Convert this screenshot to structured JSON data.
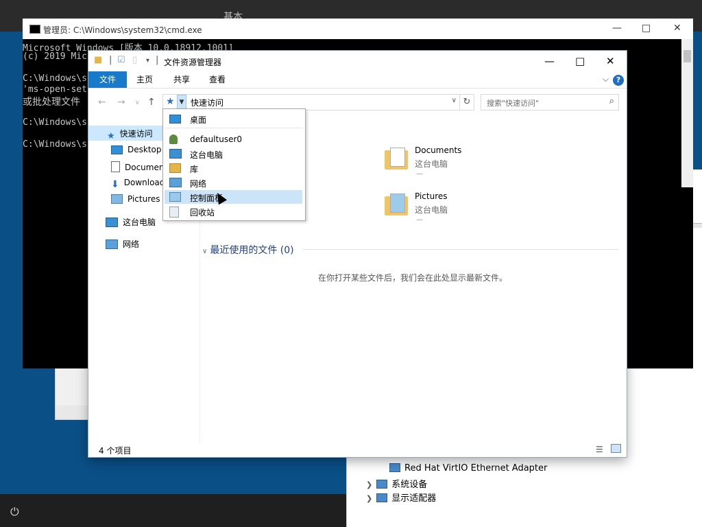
{
  "desktop": {
    "top_title": "基本"
  },
  "cmd": {
    "title": "管理员: C:\\Windows\\system32\\cmd.exe",
    "lines": [
      "Microsoft Windows [版本 10.0.18912.1001]",
      "(c) 2019 Mic",
      "C:\\Windows\\s",
      "'ms-open-set",
      "或批处理文件",
      "C:\\Windows\\s",
      "C:\\Windows\\s"
    ]
  },
  "explorer": {
    "title": "文件资源管理器",
    "ribbon": {
      "tabs": [
        "文件",
        "主页",
        "共享",
        "查看"
      ]
    },
    "address": {
      "text": "快速访问"
    },
    "search": {
      "placeholder": "搜索\"快速访问\""
    },
    "nav": {
      "quick_access": "快速访问",
      "items": [
        "Desktop",
        "Documen",
        "Download",
        "Pictures"
      ],
      "this_pc": "这台电脑",
      "network": "网络"
    },
    "folders": [
      {
        "name": "Documents",
        "location": "这台电脑"
      },
      {
        "name": "Pictures",
        "location": "这台电脑"
      }
    ],
    "recent_header": "最近使用的文件 (0)",
    "recent_empty": "在你打开某些文件后，我们会在此处显示最新文件。",
    "status": {
      "count": "4 个项目"
    }
  },
  "dropdown": {
    "items": [
      "桌面",
      "defaultuser0",
      "这台电脑",
      "库",
      "网络",
      "控制面板",
      "回收站"
    ],
    "highlighted": "控制面板"
  },
  "device_manager": {
    "rows": [
      "Red Hat VirtIO Ethernet Adapter",
      "系统设备",
      "显示适配器"
    ]
  }
}
